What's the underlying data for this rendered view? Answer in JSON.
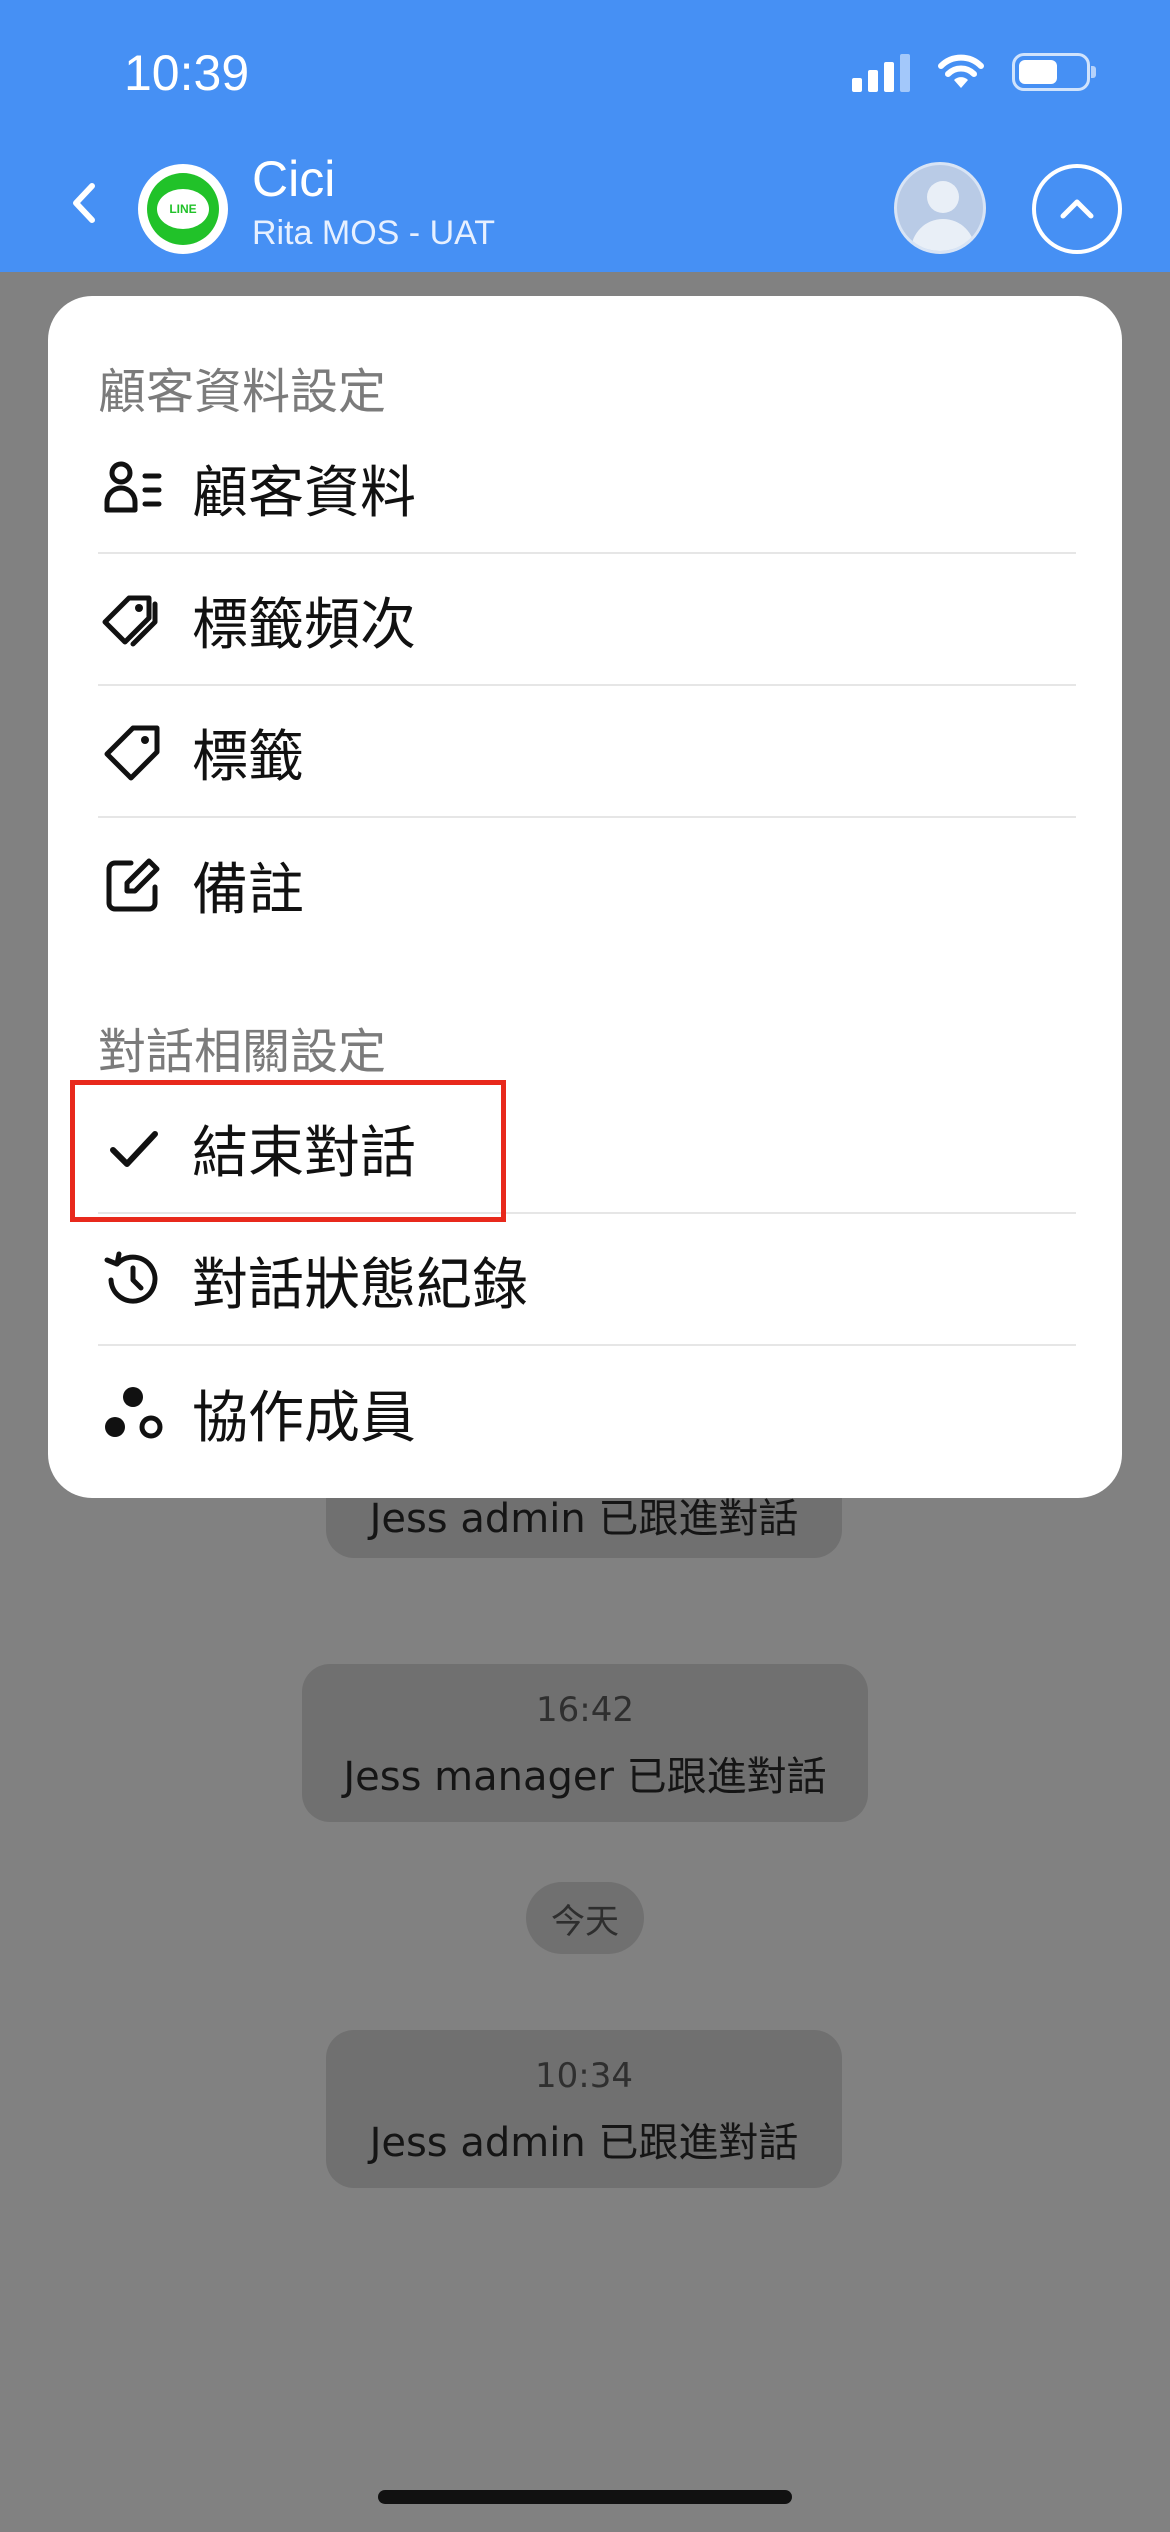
{
  "status_bar": {
    "time": "10:39"
  },
  "header": {
    "back_icon": "chevron-left-icon",
    "channel": "LINE",
    "contact_name": "Cici",
    "contact_sub": "Rita MOS - UAT",
    "avatar_icon": "user-avatar-icon",
    "collapse_icon": "chevron-up-icon",
    "color": "#4690f4"
  },
  "menu": {
    "section_customer": "顧客資料設定",
    "customer_items": [
      {
        "label": "顧客資料",
        "icon": "user-details-icon"
      },
      {
        "label": "標籤頻次",
        "icon": "tags-icon"
      },
      {
        "label": "標籤",
        "icon": "tag-icon"
      },
      {
        "label": "備註",
        "icon": "edit-note-icon"
      }
    ],
    "section_conversation": "對話相關設定",
    "conversation_items": [
      {
        "label": "結束對話",
        "icon": "check-icon",
        "highlighted": true
      },
      {
        "label": "對話狀態紀錄",
        "icon": "history-icon"
      },
      {
        "label": "協作成員",
        "icon": "collaborators-icon"
      }
    ],
    "highlight_color": "#e8291c"
  },
  "chat": {
    "msg1_partial": "Jess admin 已跟進對話",
    "msg2_time": "16:42",
    "msg2_text": "Jess manager 已跟進對話",
    "date_chip": "今天",
    "msg3_time": "10:34",
    "msg3_text": "Jess admin 已跟進對話"
  }
}
